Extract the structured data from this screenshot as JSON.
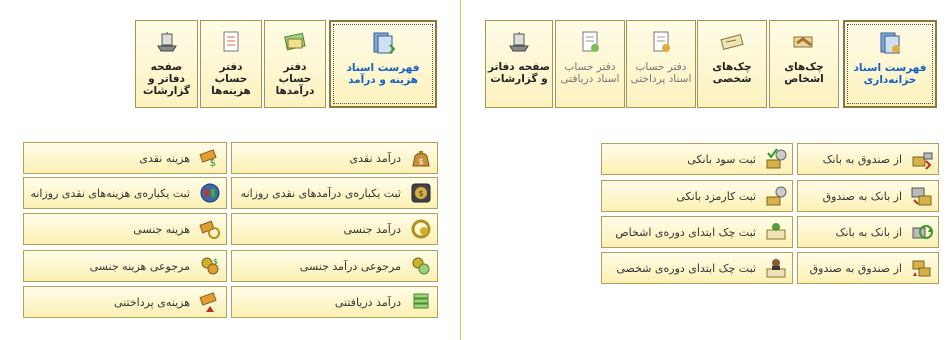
{
  "treasury_tiles": [
    {
      "label": "فهرست اسناد خزانه‌داری",
      "icon": "document-folder-icon",
      "active": true
    },
    {
      "label": "چک‌های اشخاص",
      "icon": "handshake-cheque-icon"
    },
    {
      "label": "چک‌های شخصی",
      "icon": "cheque-icon"
    },
    {
      "label": "دفتر حساب اسناد پرداختی",
      "icon": "ledger-payment-icon",
      "light": true
    },
    {
      "label": "دفتر حساب اسناد دریافتی",
      "icon": "ledger-receipt-icon",
      "light": true
    },
    {
      "label": "صفحه دفاتر و گزارشات",
      "icon": "report-ship-icon"
    }
  ],
  "expense_tiles": [
    {
      "label": "فهرست اسناد هزینه و درآمد",
      "icon": "document-folder-icon",
      "active": true
    },
    {
      "label": "دفتر حساب درآمدها",
      "icon": "income-ledger-icon"
    },
    {
      "label": "دفتر حساب هزینه‌ها",
      "icon": "expense-ledger-icon"
    },
    {
      "label": "صفحه دفاتر و گزارشات",
      "icon": "report-ship-icon"
    }
  ],
  "treasury_actions": {
    "right": [
      {
        "label": "از صندوق به بانک",
        "icon": "cash-to-bank-icon"
      },
      {
        "label": "از بانک به صندوق",
        "icon": "bank-to-cash-icon"
      },
      {
        "label": "از بانک به بانک",
        "icon": "bank-to-bank-icon"
      },
      {
        "label": "از صندوق به صندوق",
        "icon": "cash-to-cash-icon"
      }
    ],
    "left": [
      {
        "label": "ثبت سود بانکی",
        "icon": "bank-interest-icon"
      },
      {
        "label": "ثبت کارمزد بانکی",
        "icon": "bank-fee-icon"
      },
      {
        "label": "ثبت چک ابتدای دوره‌ی اشخاص",
        "icon": "opening-cheque-persons-icon"
      },
      {
        "label": "ثبت چک ابتدای دوره‌ی شخصی",
        "icon": "opening-cheque-personal-icon"
      }
    ]
  },
  "income_expense_actions": {
    "right": [
      {
        "label": "درآمد نقدی",
        "icon": "money-bag-icon"
      },
      {
        "label": "ثبت یکباره‌ی درآمدهای نقدی روزانه",
        "icon": "daily-income-icon"
      },
      {
        "label": "درآمد جنسی",
        "icon": "in-kind-income-icon"
      },
      {
        "label": "مرجوعی درآمد جنسی",
        "icon": "return-income-icon"
      },
      {
        "label": "درآمد دریافتنی",
        "icon": "receivable-stack-icon"
      }
    ],
    "left": [
      {
        "label": "هزینه نقدی",
        "icon": "cash-expense-icon"
      },
      {
        "label": "ثبت یکباره‌ی هزینه‌های نقدی روزانه",
        "icon": "daily-expense-icon"
      },
      {
        "label": "هزینه جنسی",
        "icon": "in-kind-expense-icon"
      },
      {
        "label": "مرجوعی هزینه جنسی",
        "icon": "return-expense-icon"
      },
      {
        "label": "هزینه‌ی پرداختنی",
        "icon": "payable-expense-icon"
      }
    ]
  }
}
